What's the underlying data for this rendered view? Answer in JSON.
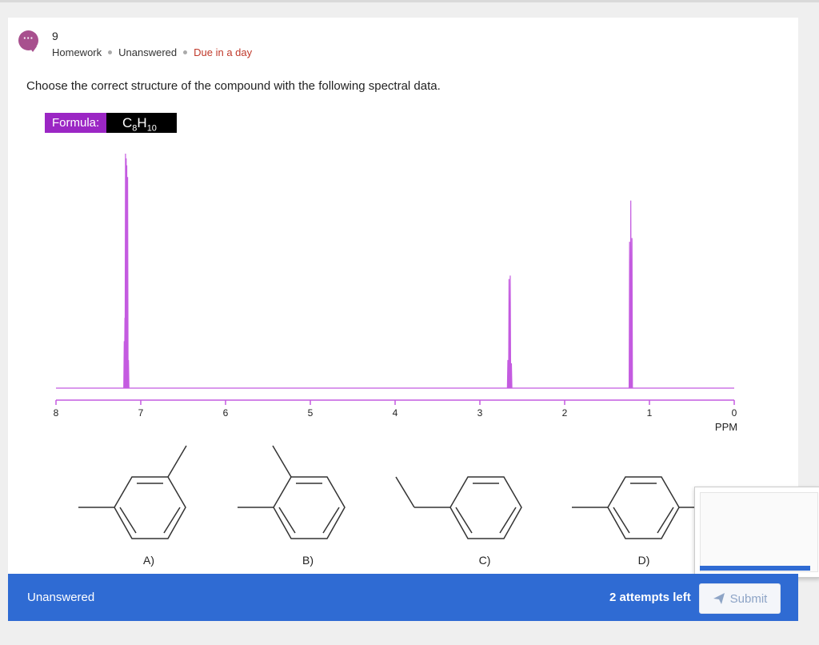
{
  "question": {
    "number": "9",
    "meta": [
      "Homework",
      "Unanswered",
      "Due in a day"
    ],
    "prompt": "Choose the correct structure of the compound with the following spectral data.",
    "formula_label": "Formula:",
    "formula_base": "C",
    "formula_sub1": "8",
    "formula_mid": "H",
    "formula_sub2": "10"
  },
  "chart_data": {
    "type": "line",
    "title": "",
    "xlabel": "PPM",
    "ylabel": "",
    "x_ticks": [
      "8",
      "7",
      "6",
      "5",
      "4",
      "3",
      "2",
      "1",
      "0"
    ],
    "xlim": [
      8,
      0
    ],
    "ylim": [
      0,
      1
    ],
    "peaks": [
      {
        "ppm": 7.18,
        "height": 1.0,
        "multiplicity": "multiplet"
      },
      {
        "ppm": 2.65,
        "height": 0.48,
        "multiplicity": "quartet"
      },
      {
        "ppm": 1.22,
        "height": 0.8,
        "multiplicity": "triplet"
      }
    ],
    "line_color": "#c45be0"
  },
  "choices": [
    {
      "label": "A)"
    },
    {
      "label": "B)"
    },
    {
      "label": "C)"
    },
    {
      "label": "D)"
    }
  ],
  "footer": {
    "status": "Unanswered",
    "attempts": "2 attempts left",
    "submit_label": "Submit"
  },
  "colors": {
    "accent": "#2f6bd3",
    "due": "#c0392b",
    "formula_label_bg": "#9b26c4"
  },
  "icons": {
    "avatar": "chat-bubble-icon",
    "submit": "paper-plane-icon"
  }
}
